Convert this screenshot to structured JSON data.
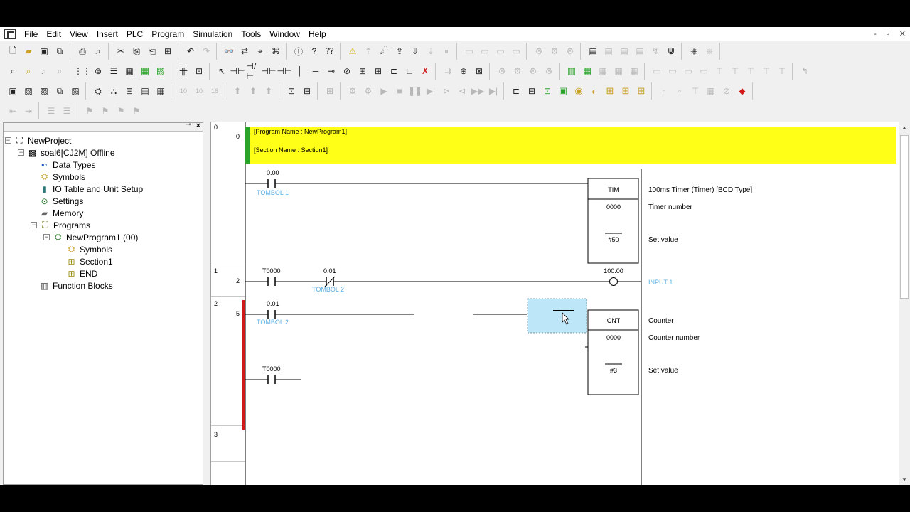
{
  "menu": [
    "File",
    "Edit",
    "View",
    "Insert",
    "PLC",
    "Program",
    "Simulation",
    "Tools",
    "Window",
    "Help"
  ],
  "window_controls": [
    "-",
    "▫",
    "✕"
  ],
  "tree": {
    "project": "NewProject",
    "plc": "soal6[CJ2M] Offline",
    "data_types": "Data Types",
    "symbols": "Symbols",
    "io_table": "IO Table and Unit Setup",
    "settings": "Settings",
    "memory": "Memory",
    "programs": "Programs",
    "program1": "NewProgram1 (00)",
    "prog_symbols": "Symbols",
    "section1": "Section1",
    "end": "END",
    "function_blocks": "Function Blocks"
  },
  "ladder": {
    "rung0": {
      "rung_no": "0",
      "step_no": "0",
      "program_name": "[Program Name : NewProgram1]",
      "section_name": "[Section Name : Section1]",
      "contact_addr": "0.00",
      "contact_comment": "TOMBOL 1",
      "instr": "TIM",
      "instr_desc": "100ms Timer (Timer) [BCD Type]",
      "op1": "0000",
      "op1_desc": "Timer number",
      "op2": "#50",
      "op2_desc": "Set value"
    },
    "rung1": {
      "rung_no": "1",
      "step_no": "2",
      "c1_addr": "T0000",
      "c2_addr": "0.01",
      "c2_comment": "TOMBOL 2",
      "coil_addr": "100.00",
      "coil_comment": "INPUT 1"
    },
    "rung2": {
      "rung_no": "2",
      "step_no": "5",
      "c1_addr": "0.01",
      "c1_comment": "TOMBOL 2",
      "c2_addr": "T0000",
      "instr": "CNT",
      "instr_desc": "Counter",
      "op1": "0000",
      "op1_desc": "Counter number",
      "op2": "#3",
      "op2_desc": "Set value"
    },
    "rung3": {
      "rung_no": "3"
    }
  },
  "colors": {
    "header_bar": "#ffff18",
    "header_marker": "#2aa52a",
    "error_bar": "#d01818",
    "comment": "#5bb0e6",
    "selection": "#bde6f8"
  }
}
